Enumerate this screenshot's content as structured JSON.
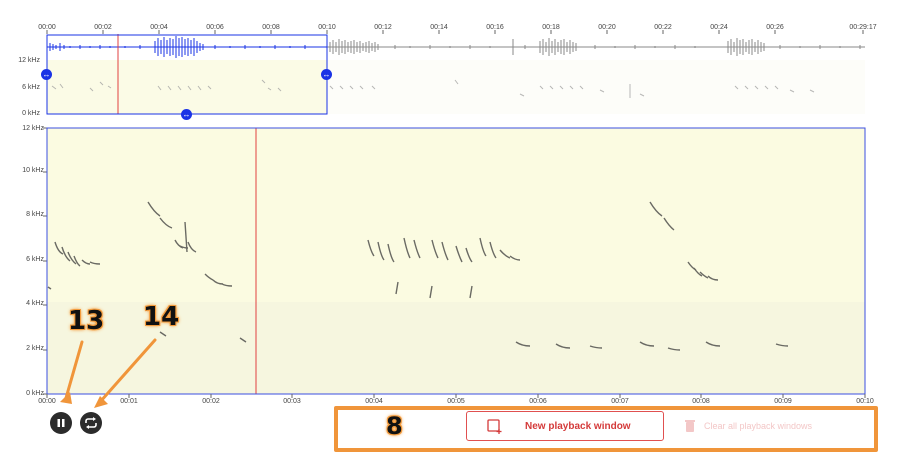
{
  "overview": {
    "time_ticks": [
      "00:00",
      "00:02",
      "00:04",
      "00:06",
      "00:08",
      "00:10",
      "00:12",
      "00:14",
      "00:16",
      "00:18",
      "00:20",
      "00:22",
      "00:24",
      "00:26",
      "00:29:17"
    ],
    "freq_labels": [
      "12 kHz",
      "6 kHz",
      "0 kHz"
    ]
  },
  "main": {
    "freq_labels": [
      "12 kHz",
      "10 kHz",
      "8 kHz",
      "6 kHz",
      "4 kHz",
      "2 kHz",
      "0 kHz"
    ],
    "time_ticks": [
      "00:00",
      "00:01",
      "00:02",
      "00:03",
      "00:04",
      "00:05",
      "00:06",
      "00:07",
      "00:08",
      "00:09",
      "00:10"
    ]
  },
  "controls": {
    "pause_icon": "pause-icon",
    "loop_icon": "repeat-icon"
  },
  "annotations": {
    "label_13": "13",
    "label_14": "14",
    "label_8": "8"
  },
  "toolbar": {
    "new_label": "New playback window",
    "clear_label": "Clear all playback windows"
  },
  "colors": {
    "accent_red": "#d43a3a",
    "selection_blue": "#1a33e6",
    "highlight_orange": "#f0953a"
  }
}
